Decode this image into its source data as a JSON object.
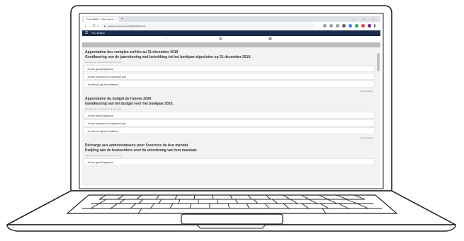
{
  "browser": {
    "tab_title": "Proxy DEMO - Votes vasnou...",
    "tab_close": "×",
    "new_tab": "+",
    "window_controls": "– □ ×",
    "back": "←",
    "forward": "→",
    "reload": "C",
    "home": "⌂",
    "url": "votedemo.example.be/DEMO/2020/vote"
  },
  "app": {
    "menu_icon": "☰",
    "title": "TILLEMAN",
    "icons": [
      "⁞",
      "▤",
      "▦"
    ]
  },
  "sections": [
    {
      "title": "Approbation des comptes arrêtés au 31 décembre 2019",
      "subtitle": "Goedkeuring van de jaarrekening met betrekking tot het boekjaar afgesloten op 31 december 2019.",
      "hint": "Sélection ter identification de vos choix",
      "options": [
        "Je keur goed/J'approuve",
        "Je keur niet goed/Je n'approuve pas",
        "Je onthoud mij/Je m'abstiens"
      ],
      "cancel": "ANNULEER"
    },
    {
      "title": "Approbation du budget de l'année 2020",
      "subtitle": "Goedkeuring van het budget voor het boekjaar 2020.",
      "hint": "Sélection ter identification de vos choix",
      "options": [
        "Je keur goed/J'approuve",
        "Je keur niet goed/Je n'approuve pas",
        "Je onthoud mij/Je m'abstiens"
      ],
      "cancel": "ANNULEER"
    },
    {
      "title": "Décharge aux administrateurs pour l'exercice de leur mandat",
      "subtitle": "Kwijting aan de bestuurders voor de uitoefening van hun mandaat.",
      "hint": "Sélection ter identification de vos choix",
      "options": [
        "Je keur goed/J'approuve"
      ],
      "cancel": ""
    }
  ]
}
